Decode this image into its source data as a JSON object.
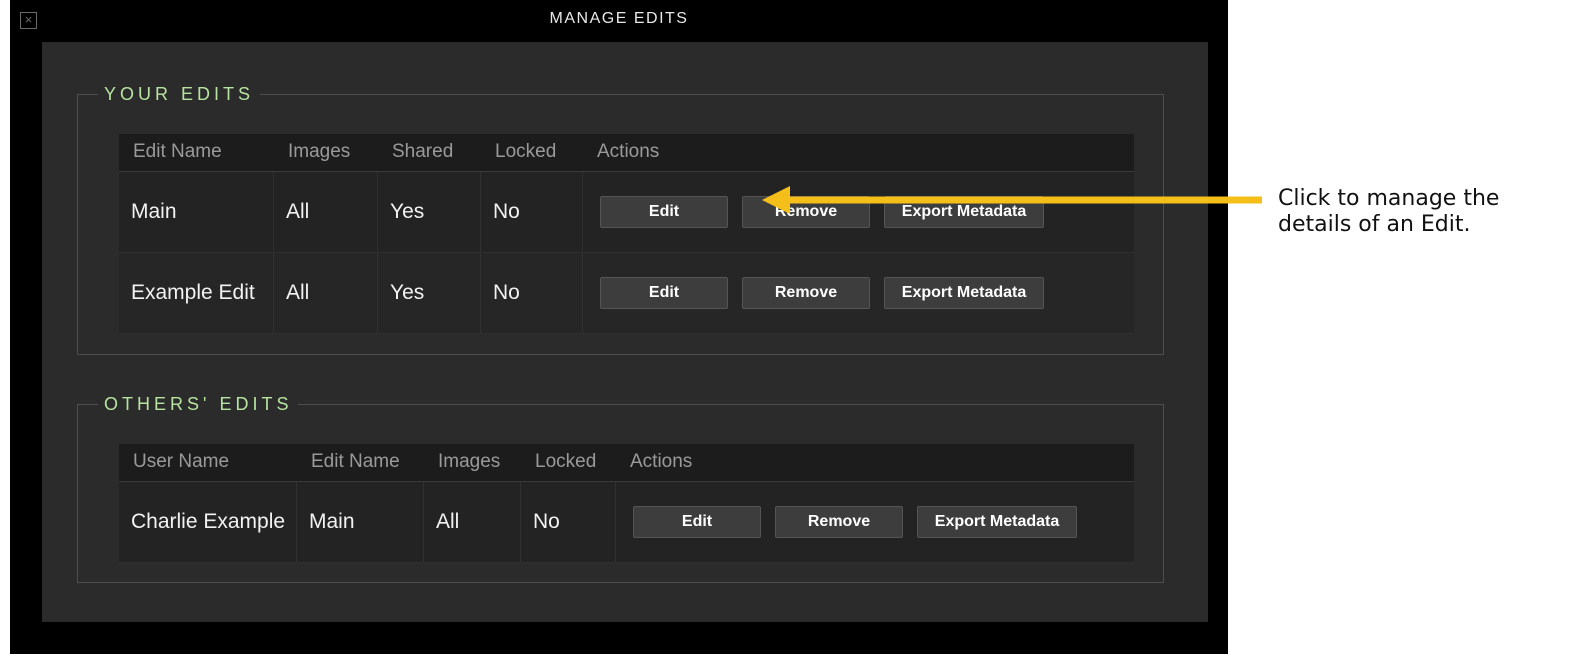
{
  "window": {
    "title": "MANAGE EDITS",
    "close_icon": "close-icon"
  },
  "your_edits": {
    "legend": "YOUR EDITS",
    "headers": [
      "Edit Name",
      "Images",
      "Shared",
      "Locked",
      "Actions"
    ],
    "rows": [
      {
        "name": "Main",
        "images": "All",
        "shared": "Yes",
        "locked": "No"
      },
      {
        "name": "Example Edit",
        "images": "All",
        "shared": "Yes",
        "locked": "No"
      }
    ]
  },
  "others_edits": {
    "legend": "OTHERS' EDITS",
    "headers": [
      "User Name",
      "Edit Name",
      "Images",
      "Locked",
      "Actions"
    ],
    "rows": [
      {
        "user": "Charlie Example",
        "name": "Main",
        "images": "All",
        "locked": "No"
      }
    ]
  },
  "buttons": {
    "edit": "Edit",
    "remove": "Remove",
    "export": "Export Metadata"
  },
  "annotation": {
    "text_line1": "Click to manage the",
    "text_line2": "details of an Edit.",
    "arrow_color": "#f5bf1a"
  },
  "colors": {
    "legend": "#b7e4a0",
    "panel": "#2b2b2b",
    "window": "#000000"
  }
}
